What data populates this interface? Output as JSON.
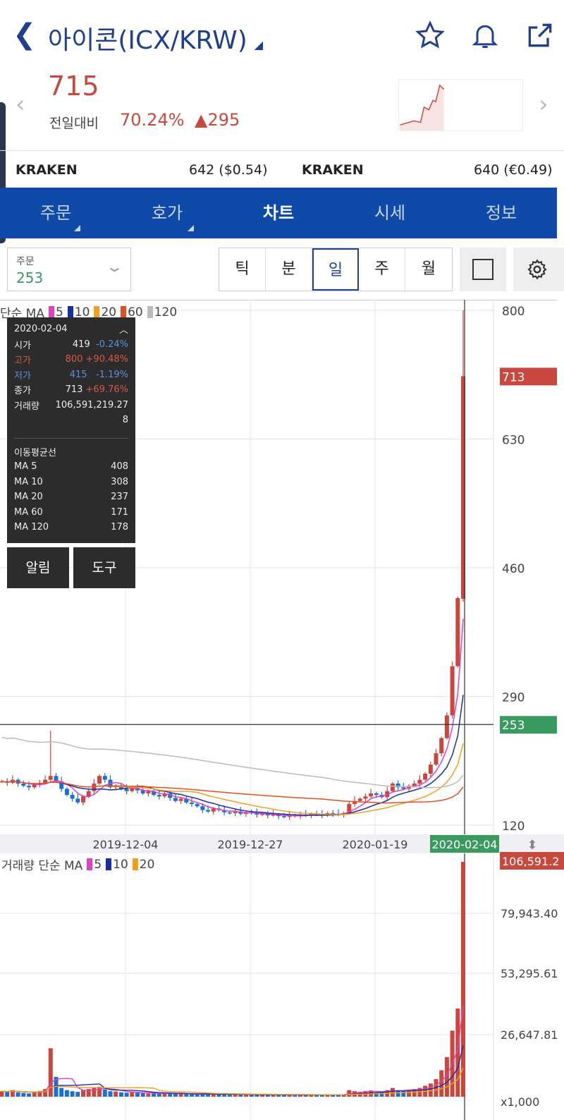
{
  "header": {
    "title": "아이콘(ICX/KRW)",
    "back_icon": "chevron-left-icon",
    "icons": [
      "star-icon",
      "bell-icon",
      "share-icon"
    ]
  },
  "quote": {
    "price": "715",
    "change_label": "전일대비",
    "change_pct": "70.24%",
    "change_amt": "▲295"
  },
  "exchanges": [
    {
      "name": "KRAKEN",
      "value": "642 ($0.54)"
    },
    {
      "name": "KRAKEN",
      "value": "640 (€0.49)"
    }
  ],
  "tabs": [
    {
      "label": "주문"
    },
    {
      "label": "호가"
    },
    {
      "label": "차트"
    },
    {
      "label": "시세"
    },
    {
      "label": "정보"
    }
  ],
  "toolbar": {
    "order_label": "주문",
    "order_value": "253",
    "periods": [
      "틱",
      "분",
      "일",
      "주",
      "월"
    ],
    "selected_period": "일"
  },
  "legend": {
    "price": "단순 MA",
    "ma": [
      "5",
      "10",
      "20",
      "60",
      "120"
    ],
    "volume": "거래량 단순 MA",
    "vol_ma": [
      "5",
      "10",
      "20"
    ]
  },
  "colors": {
    "up": "#c9483d",
    "down": "#1e6fd0",
    "ma5": "#e040c0",
    "ma10": "#1a2f9e",
    "ma20": "#f0a020",
    "ma60": "#e05020",
    "ma120": "#bbbbbb",
    "cursor_label": "#3a9a60",
    "brand": "#0f4aa8"
  },
  "tooltip": {
    "date": "2020-02-04",
    "rows": [
      {
        "label": "시가",
        "value": "419",
        "pct": "-0.24%",
        "cls": "down"
      },
      {
        "label": "고가",
        "value": "800",
        "pct": "+90.48%",
        "cls": "up"
      },
      {
        "label": "저가",
        "value": "415",
        "pct": "-1.19%",
        "cls": "down"
      },
      {
        "label": "종가",
        "value": "713",
        "pct": "+69.76%",
        "cls": "up"
      }
    ],
    "volume_label": "거래량",
    "volume_value": "106,591,219.27",
    "volume_tail": "8",
    "ma_title": "이동평균선",
    "ma": [
      {
        "label": "MA 5",
        "value": "408"
      },
      {
        "label": "MA 10",
        "value": "308"
      },
      {
        "label": "MA 20",
        "value": "237"
      },
      {
        "label": "MA 60",
        "value": "171"
      },
      {
        "label": "MA 120",
        "value": "178"
      }
    ]
  },
  "buttons": {
    "alert": "알림",
    "tools": "도구"
  },
  "chart_data": {
    "type": "candlestick",
    "price_ticks": [
      "800",
      "630",
      "460",
      "290",
      "120"
    ],
    "price_range": [
      120,
      800
    ],
    "last_price_label": "713",
    "cursor_price_label": "253",
    "cursor_price": 253,
    "date_ticks": [
      "2019-12-04",
      "2019-12-27",
      "2020-01-19"
    ],
    "cursor_date": "2020-02-04",
    "closes": [
      178,
      176,
      180,
      175,
      172,
      170,
      174,
      176,
      180,
      185,
      178,
      168,
      160,
      155,
      150,
      158,
      165,
      175,
      185,
      180,
      170,
      172,
      168,
      165,
      170,
      166,
      162,
      165,
      160,
      158,
      162,
      156,
      152,
      155,
      150,
      148,
      145,
      140,
      138,
      142,
      140,
      137,
      136,
      138,
      135,
      137,
      136,
      134,
      135,
      133,
      134,
      132,
      131,
      133,
      132,
      134,
      133,
      135,
      134,
      133,
      136,
      135,
      134,
      136,
      148,
      152,
      155,
      158,
      162,
      160,
      157,
      165,
      175,
      170,
      168,
      172,
      175,
      180,
      188,
      200,
      215,
      235,
      265,
      330,
      420
    ],
    "last_candle": {
      "o": 419,
      "h": 800,
      "l": 415,
      "c": 713
    },
    "volume_ticks": [
      "106,591.2",
      "79,943.40",
      "53,295.61",
      "26,647.81",
      "x1,000"
    ],
    "volume_max": 106591.2,
    "volumes": [
      2500,
      2200,
      3000,
      2000,
      1800,
      1500,
      2000,
      2600,
      3500,
      22000,
      9000,
      4000,
      3000,
      2500,
      2200,
      3000,
      3500,
      4000,
      4500,
      3200,
      2500,
      2400,
      2000,
      1800,
      2200,
      1800,
      1600,
      1500,
      1500,
      1400,
      1600,
      1500,
      1300,
      1200,
      1200,
      1100,
      1200,
      1400,
      1300,
      1200,
      1100,
      1000,
      1000,
      1100,
      1000,
      1000,
      900,
      900,
      1000,
      900,
      900,
      800,
      800,
      900,
      800,
      900,
      800,
      900,
      900,
      800,
      1000,
      900,
      900,
      1000,
      3000,
      2500,
      2200,
      2600,
      2800,
      2000,
      1800,
      3000,
      4000,
      2800,
      2500,
      3000,
      3500,
      4000,
      5000,
      6000,
      8000,
      12000,
      18000,
      30000,
      40000,
      106591
    ]
  }
}
